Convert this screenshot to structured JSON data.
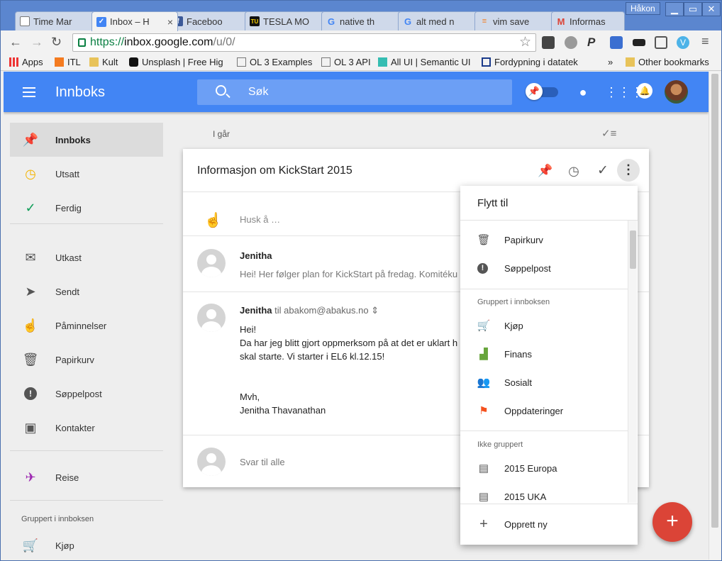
{
  "browser": {
    "tabs": [
      {
        "title": "Time Mar",
        "fav": "document-icon"
      },
      {
        "title": "Inbox – H",
        "fav": "inbox-icon"
      },
      {
        "title": "Faceboo",
        "fav": "facebook-icon"
      },
      {
        "title": "TESLA MO",
        "fav": "tu-icon"
      },
      {
        "title": "native th",
        "fav": "google-icon"
      },
      {
        "title": "alt med n",
        "fav": "google-icon"
      },
      {
        "title": "vim save",
        "fav": "stackoverflow-icon"
      },
      {
        "title": "Informas",
        "fav": "gmail-icon"
      }
    ],
    "user": "Håkon",
    "url": {
      "scheme": "https://",
      "host": "inbox.google.com",
      "path": "/u/0/"
    },
    "bookmarks": [
      {
        "label": "Apps"
      },
      {
        "label": "ITL"
      },
      {
        "label": "Kult"
      },
      {
        "label": "Unsplash | Free Hig"
      },
      {
        "label": "OL 3 Examples"
      },
      {
        "label": "OL 3 API"
      },
      {
        "label": "All UI | Semantic UI"
      },
      {
        "label": "Fordypning i datatek"
      },
      {
        "label": "»"
      },
      {
        "label": "Other bookmarks"
      }
    ]
  },
  "app": {
    "title": "Innboks",
    "search_placeholder": "Søk"
  },
  "sidebar": {
    "items": [
      {
        "label": "Innboks",
        "icon": "pin-icon",
        "color": "#4285f4"
      },
      {
        "label": "Utsatt",
        "icon": "clock-icon",
        "color": "#f4b400"
      },
      {
        "label": "Ferdig",
        "icon": "check-icon",
        "color": "#0f9d58"
      },
      {
        "label": "Utkast",
        "icon": "drafts-icon",
        "color": "#555555"
      },
      {
        "label": "Sendt",
        "icon": "send-icon",
        "color": "#555555"
      },
      {
        "label": "Påminnelser",
        "icon": "reminder-icon",
        "color": "#555555"
      },
      {
        "label": "Papirkurv",
        "icon": "trash-icon",
        "color": "#555555"
      },
      {
        "label": "Søppelpost",
        "icon": "spam-icon",
        "color": "#555555"
      },
      {
        "label": "Kontakter",
        "icon": "contacts-icon",
        "color": "#555555"
      },
      {
        "label": "Reise",
        "icon": "plane-icon",
        "color": "#9c27b0"
      },
      {
        "label": "Kjøp",
        "icon": "cart-icon",
        "color": "#555555"
      }
    ],
    "section": "Gruppert i innboksen"
  },
  "main": {
    "day_label": "I går",
    "thread": {
      "subject": "Informasjon om KickStart 2015",
      "reminder_placeholder": "Husk å …",
      "messages": [
        {
          "sender": "Jenitha",
          "snippet": "Hei! Her følger plan for KickStart på fredag. Komitéku"
        },
        {
          "sender": "Jenitha",
          "to": "til abakom@abakus.no",
          "body": "Hei!\nDa har jeg blitt gjort oppmerksom på at det er uklart h\nskal starte. Vi starter i EL6 kl.12.15!\n\n\nMvh,\nJenitha Thavanathan"
        }
      ],
      "reply_placeholder": "Svar til alle"
    }
  },
  "move_menu": {
    "title": "Flytt til",
    "top_items": [
      {
        "label": "Papirkurv",
        "icon": "trash-icon",
        "color": "#555555"
      },
      {
        "label": "Søppelpost",
        "icon": "spam-icon",
        "color": "#555555"
      }
    ],
    "grouped_section": "Gruppert i innboksen",
    "grouped_items": [
      {
        "label": "Kjøp",
        "icon": "cart-icon",
        "color": "#555555"
      },
      {
        "label": "Finans",
        "icon": "finance-icon",
        "color": "#67a53b"
      },
      {
        "label": "Sosialt",
        "icon": "people-icon",
        "color": "#db4437"
      },
      {
        "label": "Oppdateringer",
        "icon": "flag-icon",
        "color": "#f4511e"
      }
    ],
    "ungrouped_section": "Ikke gruppert",
    "ungrouped_items": [
      {
        "label": "2015 Europa",
        "icon": "label-inbox-icon",
        "color": "#555555"
      },
      {
        "label": "2015 UKA",
        "icon": "label-inbox-icon",
        "color": "#555555"
      }
    ],
    "create": {
      "label": "Opprett ny",
      "icon": "plus-icon"
    }
  },
  "fab": {
    "icon": "plus-icon",
    "symbol": "+"
  }
}
